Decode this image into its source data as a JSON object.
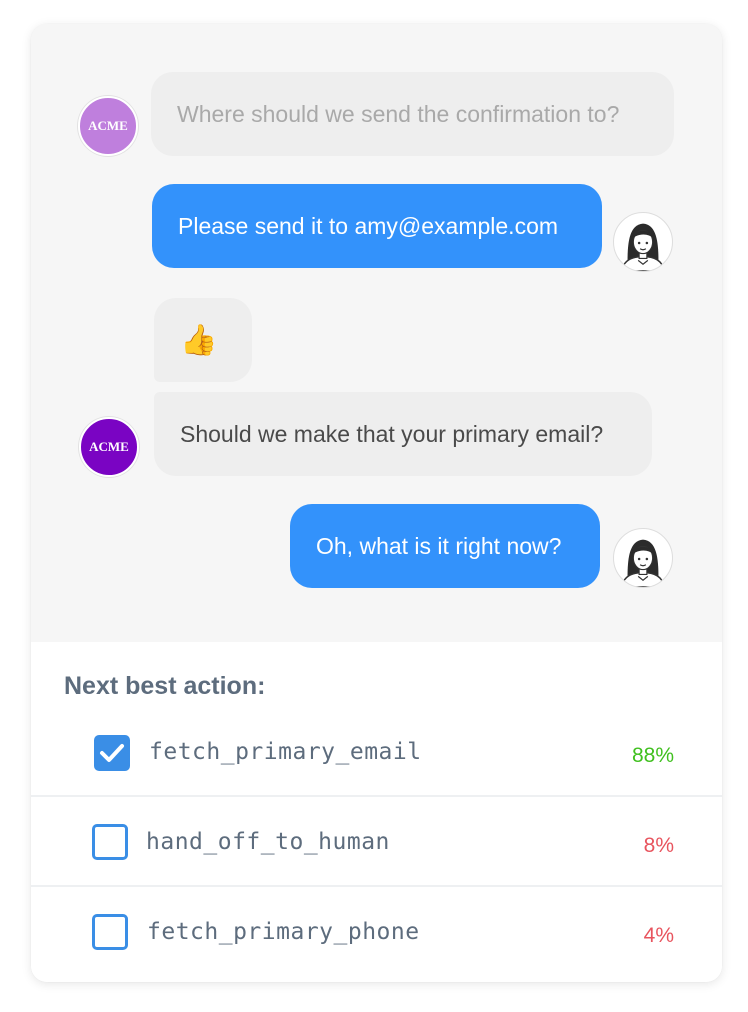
{
  "chat": {
    "messages": [
      {
        "sender": "bot",
        "text": "Where should we send the confirmation to?"
      },
      {
        "sender": "user",
        "text": "Please send it to amy@example.com"
      },
      {
        "sender": "bot",
        "text": "👍"
      },
      {
        "sender": "bot",
        "text": "Should we make that your primary email?"
      },
      {
        "sender": "user",
        "text": "Oh, what is it right now?"
      }
    ],
    "bot_avatar_label": "ACME",
    "bot_avatar_colors": [
      "#bf7fdd",
      "#7a04c3"
    ],
    "user_bubble_color": "#3392fb"
  },
  "next_best_action": {
    "title": "Next best action:",
    "actions": [
      {
        "name": "fetch_primary_email",
        "percent": "88%",
        "checked": true,
        "color": "#40c01f"
      },
      {
        "name": "hand_off_to_human",
        "percent": "8%",
        "checked": false,
        "color": "#e8545e"
      },
      {
        "name": "fetch_primary_phone",
        "percent": "4%",
        "checked": false,
        "color": "#e8545e"
      }
    ]
  }
}
